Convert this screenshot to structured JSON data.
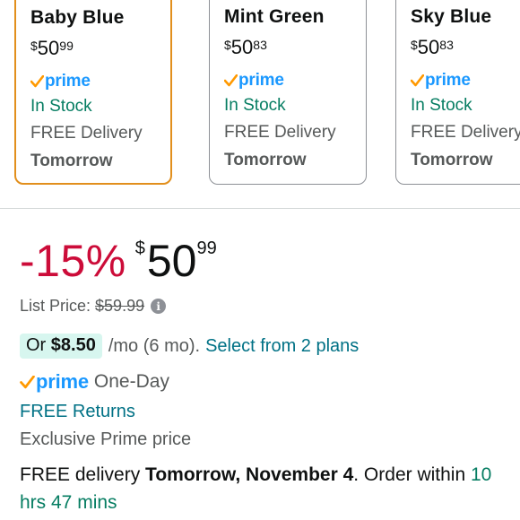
{
  "variants": [
    {
      "name": "Baby Blue",
      "currency": "$",
      "whole": "50",
      "fraction": "99",
      "prime": "prime",
      "stock": "In Stock",
      "delivery": "FREE Delivery",
      "day": "Tomorrow",
      "selected": true
    },
    {
      "name": "Mint Green",
      "currency": "$",
      "whole": "50",
      "fraction": "83",
      "prime": "prime",
      "stock": "In Stock",
      "delivery": "FREE Delivery",
      "day": "Tomorrow",
      "selected": false
    },
    {
      "name": "Sky Blue",
      "currency": "$",
      "whole": "50",
      "fraction": "83",
      "prime": "prime",
      "stock": "In Stock",
      "delivery": "FREE Delivery",
      "day": "Tomorrow",
      "selected": false
    }
  ],
  "price": {
    "discount": "-15%",
    "currency": "$",
    "whole": "50",
    "fraction": "99",
    "list_label": "List Price:",
    "list_value": "$59.99",
    "info_icon": "i"
  },
  "installments": {
    "or_label": "Or",
    "amount": "$8.50",
    "term": "/mo (6 mo).",
    "link": "Select from 2 plans"
  },
  "prime_badge": {
    "word": "prime",
    "speed": "One-Day"
  },
  "returns": "FREE Returns",
  "exclusive": "Exclusive Prime price",
  "delivery": {
    "prefix": "FREE delivery",
    "date": "Tomorrow, November 4",
    "order": ". Order within",
    "countdown": "10 hrs 47 mins"
  },
  "colors": {
    "accent_discount": "#cc0c39",
    "in_stock": "#067d62",
    "link": "#007185",
    "prime_blue": "#1a98ff",
    "prime_check": "#ff9900",
    "selected_border": "#e28f1c",
    "installment_highlight": "#d7f6ef"
  }
}
